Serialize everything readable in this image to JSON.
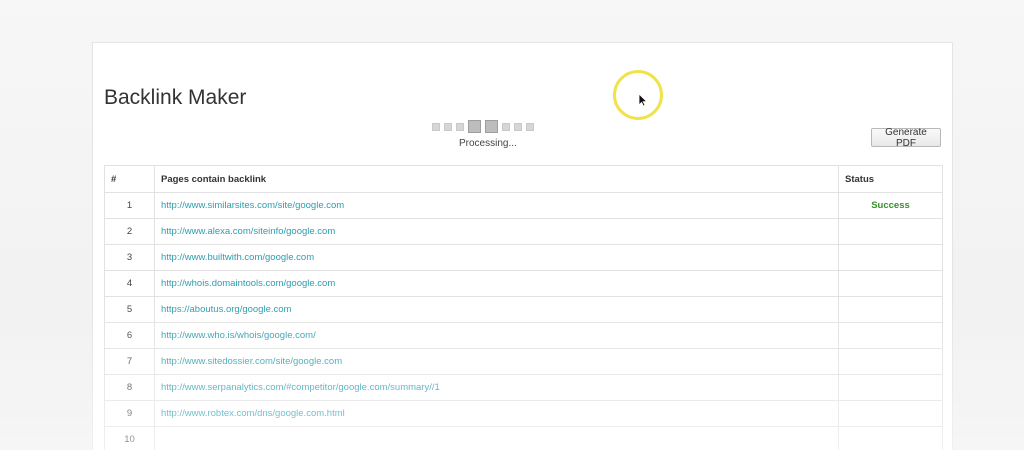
{
  "app": {
    "title": "Backlink Maker"
  },
  "progress": {
    "label": "Processing..."
  },
  "toolbar": {
    "generate_pdf_label": "Generate PDF"
  },
  "table": {
    "headers": {
      "num": "#",
      "pages": "Pages contain backlink",
      "status": "Status"
    },
    "rows": [
      {
        "num": "1",
        "url": "http://www.similarsites.com/site/google.com",
        "status": "Success"
      },
      {
        "num": "2",
        "url": "http://www.alexa.com/siteinfo/google.com",
        "status": ""
      },
      {
        "num": "3",
        "url": "http://www.builtwith.com/google.com",
        "status": ""
      },
      {
        "num": "4",
        "url": "http://whois.domaintools.com/google.com",
        "status": ""
      },
      {
        "num": "5",
        "url": "https://aboutus.org/google.com",
        "status": ""
      },
      {
        "num": "6",
        "url": "http://www.who.is/whois/google.com/",
        "status": ""
      },
      {
        "num": "7",
        "url": "http://www.sitedossier.com/site/google.com",
        "status": ""
      },
      {
        "num": "8",
        "url": "http://www.serpanalytics.com/#competitor/google.com/summary//1",
        "status": ""
      },
      {
        "num": "9",
        "url": "http://www.robtex.com/dns/google.com.html",
        "status": ""
      },
      {
        "num": "10",
        "url": "",
        "status": ""
      }
    ]
  },
  "colors": {
    "link": "#2a9fb0",
    "success": "#3a8f2e",
    "cursor_highlight": "#f0e24a"
  }
}
